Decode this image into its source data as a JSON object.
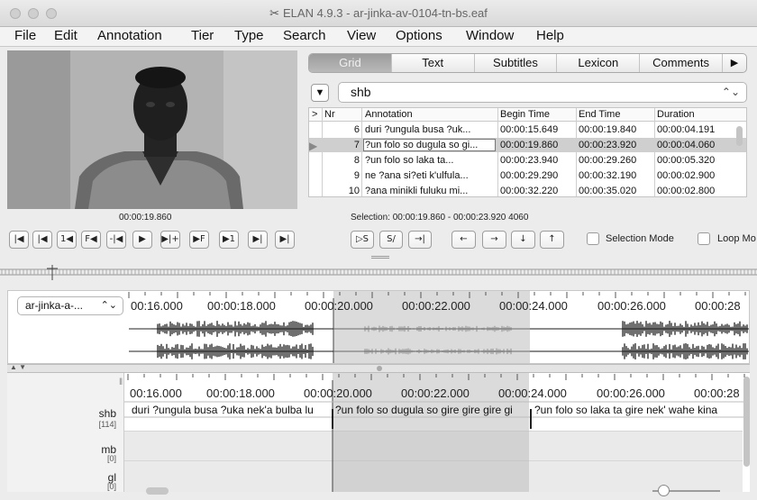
{
  "window": {
    "title": "ELAN 4.9.3 - ar-jinka-av-0104-tn-bs.eaf",
    "app_icon": "elan-logo-icon"
  },
  "menu": [
    "File",
    "Edit",
    "Annotation",
    "Tier",
    "Type",
    "Search",
    "View",
    "Options",
    "Window",
    "Help"
  ],
  "video": {
    "current_time": "00:00:19.860"
  },
  "tabs": [
    "Grid",
    "Text",
    "Subtitles",
    "Lexicon",
    "Comments"
  ],
  "active_tab": "Grid",
  "tier_select": {
    "value": "shb"
  },
  "grid": {
    "headers": {
      "marker": ">",
      "nr": "Nr",
      "annotation": "Annotation",
      "begin": "Begin Time",
      "end": "End Time",
      "duration": "Duration"
    },
    "rows": [
      {
        "nr": "6",
        "annotation": "duri ?ungula busa ?uk...",
        "begin": "00:00:15.649",
        "end": "00:00:19.840",
        "duration": "00:00:04.191",
        "selected": false
      },
      {
        "nr": "7",
        "annotation": "?un folo so dugula so gi...",
        "begin": "00:00:19.860",
        "end": "00:00:23.920",
        "duration": "00:00:04.060",
        "selected": true
      },
      {
        "nr": "8",
        "annotation": "?un folo so laka ta...",
        "begin": "00:00:23.940",
        "end": "00:00:29.260",
        "duration": "00:00:05.320",
        "selected": false
      },
      {
        "nr": "9",
        "annotation": "ne ?ana si?eti k'ulfula...",
        "begin": "00:00:29.290",
        "end": "00:00:32.190",
        "duration": "00:00:02.900",
        "selected": false
      },
      {
        "nr": "10",
        "annotation": "?ana minikli fuluku mi...",
        "begin": "00:00:32.220",
        "end": "00:00:35.020",
        "duration": "00:00:02.800",
        "selected": false
      }
    ]
  },
  "selection_info": "Selection: 00:00:19.860 - 00:00:23.920  4060",
  "controls": {
    "player_buttons": [
      "|◀",
      "|◀",
      "1◀",
      "F◀",
      "-|◀",
      "▶",
      "▶|+",
      "▶F",
      "▶1",
      "▶|",
      "▶|"
    ],
    "selection_buttons": [
      "▷S",
      "S/",
      "→|"
    ],
    "nav_buttons": [
      "←",
      "→",
      "↓",
      "↑"
    ],
    "selection_mode_label": "Selection Mode",
    "loop_mode_label": "Loop Mo"
  },
  "waveform": {
    "media_select": "ar-jinka-a-...",
    "ruler_labels": [
      "00:16.000",
      "00:00:18.000",
      "00:00:20.000",
      "00:00:22.000",
      "00:00:24.000",
      "00:00:26.000",
      "00:00:28"
    ]
  },
  "annotation_view": {
    "ruler_labels": [
      "00:16.000",
      "00:00:18.000",
      "00:00:20.000",
      "00:00:22.000",
      "00:00:24.000",
      "00:00:26.000",
      "00:00:28"
    ],
    "tiers": [
      {
        "name": "shb",
        "count": "[114]"
      },
      {
        "name": "mb",
        "count": "[0]"
      },
      {
        "name": "gl",
        "count": "[0]"
      }
    ],
    "annotations": [
      "duri ?ungula busa ?uka nek'a bulba lu",
      "?un folo so dugula so gire gire gire gi",
      "?un folo so laka ta gire nek' wahe kina"
    ]
  },
  "colors": {
    "selection": "#cfcfcf",
    "active_tab": "#a8a8a8",
    "waveform": "#111111"
  }
}
